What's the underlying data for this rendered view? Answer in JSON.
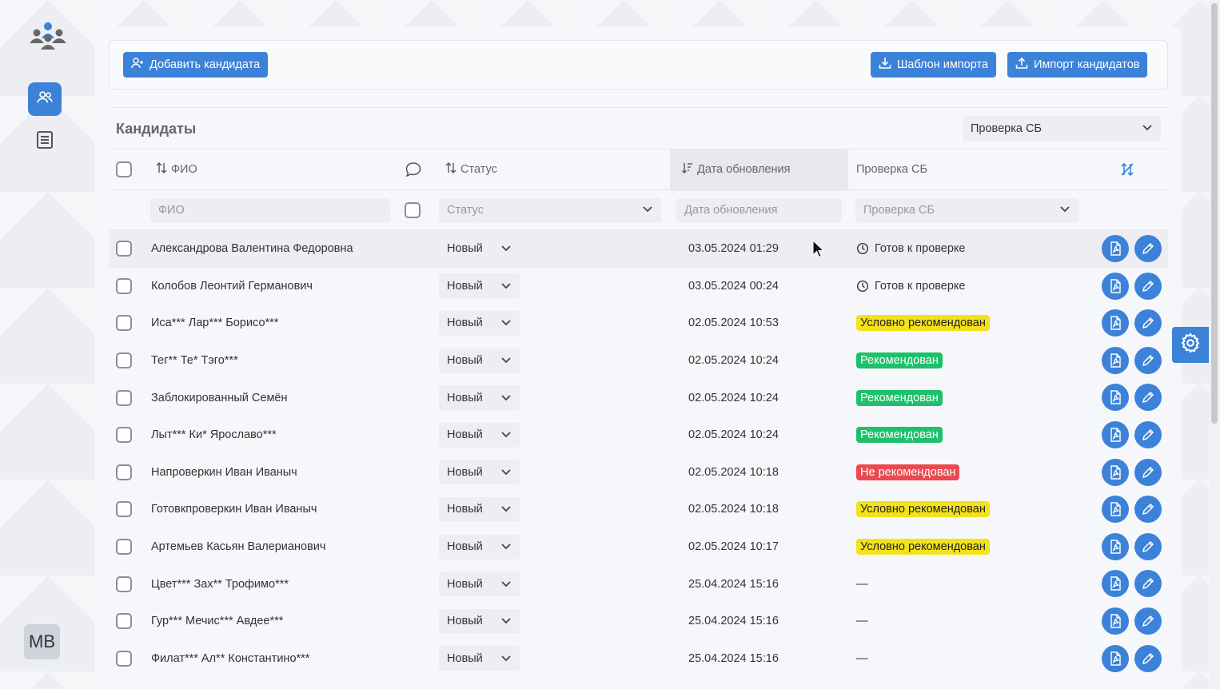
{
  "toolbar": {
    "add_label": "Добавить кандидата",
    "template_label": "Шаблон импорта",
    "import_label": "Импорт кандидатов"
  },
  "section": {
    "title": "Кандидаты",
    "view_select": "Проверка СБ"
  },
  "columns": {
    "fio": "ФИО",
    "status": "Статус",
    "updated": "Дата обновления",
    "sb_check": "Проверка СБ"
  },
  "filters": {
    "fio_placeholder": "ФИО",
    "status_placeholder": "Статус",
    "updated_placeholder": "Дата обновления",
    "sb_placeholder": "Проверка СБ"
  },
  "rows": [
    {
      "name": "Александрова Валентина Федоровна",
      "status": "Новый",
      "date": "03.05.2024 01:29",
      "sb": "Готов к проверке",
      "sb_kind": "pending"
    },
    {
      "name": "Колобов Леонтий Германович",
      "status": "Новый",
      "date": "03.05.2024 00:24",
      "sb": "Готов к проверке",
      "sb_kind": "pending"
    },
    {
      "name": "Иса*** Лар*** Борисо***",
      "status": "Новый",
      "date": "02.05.2024 10:53",
      "sb": "Условно рекомендован",
      "sb_kind": "yellow"
    },
    {
      "name": "Тег** Те* Тэго***",
      "status": "Новый",
      "date": "02.05.2024 10:24",
      "sb": "Рекомендован",
      "sb_kind": "green"
    },
    {
      "name": "Заблокированный Семён",
      "status": "Новый",
      "date": "02.05.2024 10:24",
      "sb": "Рекомендован",
      "sb_kind": "green"
    },
    {
      "name": "Лыт*** Ки* Ярославо***",
      "status": "Новый",
      "date": "02.05.2024 10:24",
      "sb": "Рекомендован",
      "sb_kind": "green"
    },
    {
      "name": "Напроверкин Иван Иваныч",
      "status": "Новый",
      "date": "02.05.2024 10:18",
      "sb": "Не рекомендован",
      "sb_kind": "red"
    },
    {
      "name": "Готовкпроверкин Иван Иваныч",
      "status": "Новый",
      "date": "02.05.2024 10:18",
      "sb": "Условно рекомендован",
      "sb_kind": "yellow"
    },
    {
      "name": "Артемьев Касьян Валерианович",
      "status": "Новый",
      "date": "02.05.2024 10:17",
      "sb": "Условно рекомендован",
      "sb_kind": "yellow"
    },
    {
      "name": "Цвет*** Зах** Трофимо***",
      "status": "Новый",
      "date": "25.04.2024 15:16",
      "sb": "—",
      "sb_kind": "none"
    },
    {
      "name": "Гур*** Мечис*** Авдее***",
      "status": "Новый",
      "date": "25.04.2024 15:16",
      "sb": "—",
      "sb_kind": "none"
    },
    {
      "name": "Филат*** Ал** Константино***",
      "status": "Новый",
      "date": "25.04.2024 15:16",
      "sb": "—",
      "sb_kind": "none"
    }
  ],
  "user": {
    "initials": "MB"
  },
  "colors": {
    "accent": "#3b82d8",
    "yellow": "#f3e21b",
    "green": "#1fc06a",
    "red": "#ea4a4f"
  }
}
